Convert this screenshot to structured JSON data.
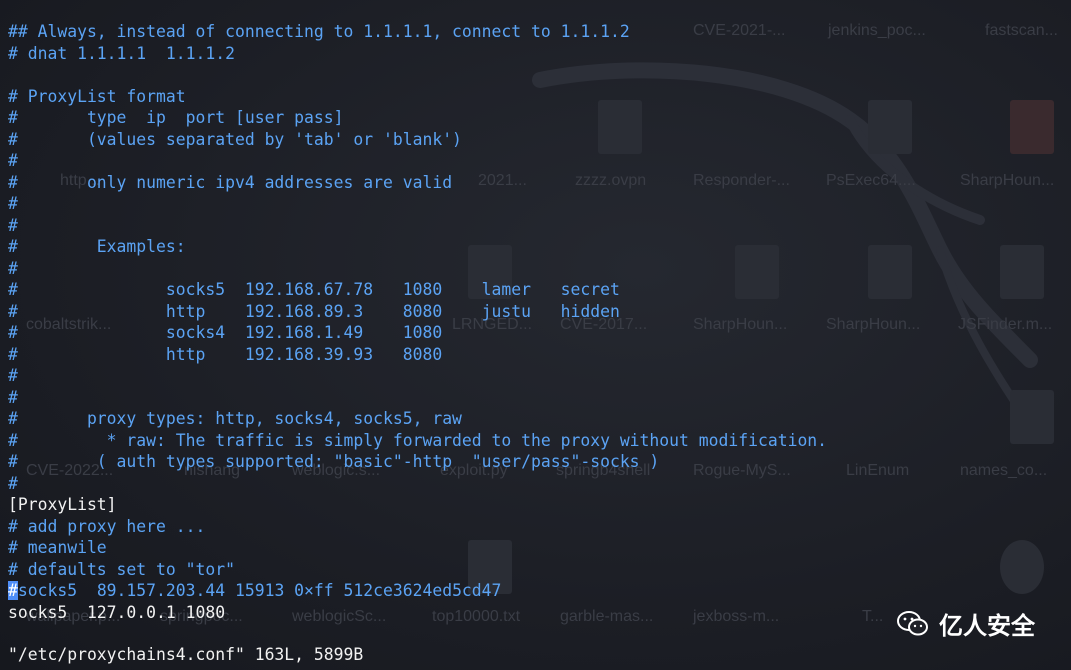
{
  "lines": [
    {
      "text": "## Always, instead of connecting to 1.1.1.1, connect to 1.1.1.2",
      "style": "comment"
    },
    {
      "text": "# dnat 1.1.1.1  1.1.1.2",
      "style": "comment"
    },
    {
      "text": "",
      "style": "comment"
    },
    {
      "text": "# ProxyList format",
      "style": "comment"
    },
    {
      "text": "#       type  ip  port [user pass]",
      "style": "comment"
    },
    {
      "text": "#       (values separated by 'tab' or 'blank')",
      "style": "comment"
    },
    {
      "text": "#",
      "style": "comment"
    },
    {
      "text": "#       only numeric ipv4 addresses are valid",
      "style": "comment"
    },
    {
      "text": "#",
      "style": "comment"
    },
    {
      "text": "#",
      "style": "comment"
    },
    {
      "text": "#        Examples:",
      "style": "comment"
    },
    {
      "text": "#",
      "style": "comment"
    },
    {
      "text": "#               socks5  192.168.67.78   1080    lamer   secret",
      "style": "comment"
    },
    {
      "text": "#               http    192.168.89.3    8080    justu   hidden",
      "style": "comment"
    },
    {
      "text": "#               socks4  192.168.1.49    1080",
      "style": "comment"
    },
    {
      "text": "#               http    192.168.39.93   8080",
      "style": "comment"
    },
    {
      "text": "#",
      "style": "comment"
    },
    {
      "text": "#",
      "style": "comment"
    },
    {
      "text": "#       proxy types: http, socks4, socks5, raw",
      "style": "comment"
    },
    {
      "text": "#         * raw: The traffic is simply forwarded to the proxy without modification.",
      "style": "comment"
    },
    {
      "text": "#        ( auth types supported: \"basic\"-http  \"user/pass\"-socks )",
      "style": "comment"
    },
    {
      "text": "#",
      "style": "comment"
    },
    {
      "text": "[ProxyList]",
      "style": "plain"
    },
    {
      "text": "# add proxy here ...",
      "style": "comment"
    },
    {
      "text": "# meanwile",
      "style": "comment"
    },
    {
      "text": "# defaults set to \"tor\"",
      "style": "comment"
    },
    {
      "text": "socks5  89.157.203.44 15913 0×ff 512ce3624ed5cd47",
      "style": "comment",
      "cursor": "#"
    },
    {
      "text": "socks5  127.0.0.1 1080",
      "style": "plain"
    }
  ],
  "status_line": "\"/etc/proxychains4.conf\" 163L, 5899B",
  "watermark": {
    "text": "亿人安全",
    "icon": "wechat-icon"
  },
  "background_labels": [
    "CVE-2021-...",
    "jenkins_poc...",
    "fastscan...",
    "http...",
    "2021...",
    "zzzz.ovpn",
    "Responder-...",
    "PsExec64....",
    "SharpHoun...",
    "cobaltstrik...",
    "LRNGED...",
    "CVE-2017...",
    "SharpHoun...",
    "SharpHoun...",
    "JSFinder.m...",
    "CVE-2022...",
    "nishang",
    "weblogic.s...",
    "exploit.py",
    "springb4shell",
    "Rogue-MyS...",
    "LinEnum",
    "names_co...",
    "wallpaper.p...",
    "springpoc...",
    "weblogicSc...",
    "top10000.txt",
    "garble-mas...",
    "jexboss-m...",
    "T..."
  ]
}
